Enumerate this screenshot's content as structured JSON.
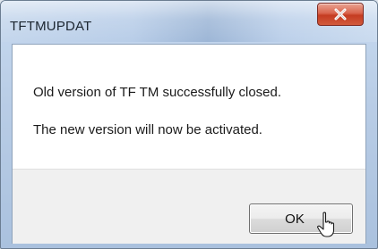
{
  "window": {
    "title": "TFTMUPDAT",
    "close_icon": "close-x-icon"
  },
  "message": {
    "line1": "Old version of TF TM successfully closed.",
    "line2": "The new version will now be activated."
  },
  "buttons": {
    "ok_label": "OK"
  },
  "cursor": {
    "icon": "hand-pointer-icon"
  },
  "colors": {
    "close_button": "#c53c22",
    "titlebar": "#b8cde8",
    "footer": "#f0f0f0"
  }
}
